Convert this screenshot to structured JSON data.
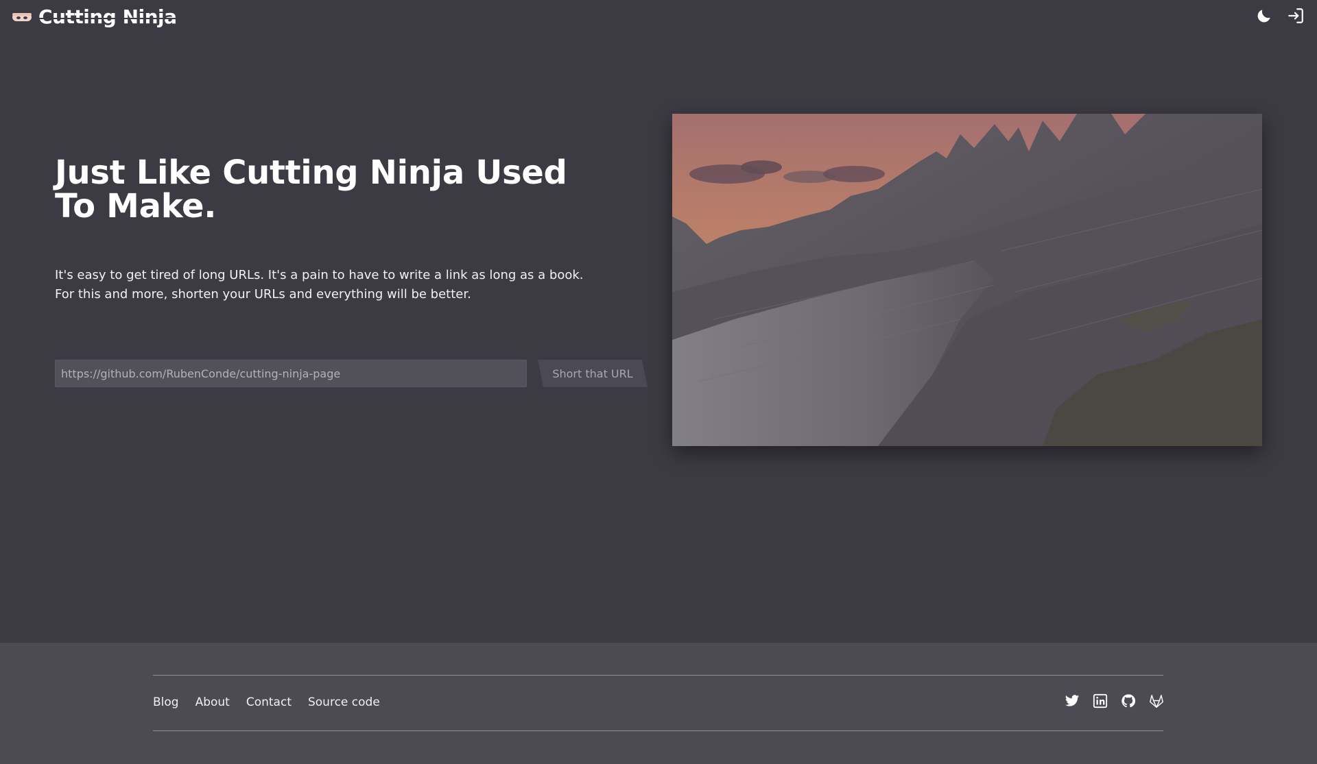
{
  "header": {
    "brand": "Cutting Ninja",
    "theme_toggle_icon": "moon-icon",
    "login_icon": "login-icon"
  },
  "hero": {
    "title": "Just Like Cutting Ninja Used To Make.",
    "description_line1": "It's easy to get tired of long URLs. It's a pain to have to write a link as long as a book.",
    "description_line2": "For this and more, shorten your URLs and everything will be better.",
    "url_placeholder": "https://github.com/RubenConde/cutting-ninja-page",
    "url_value": "",
    "submit_label": "Short that URL",
    "image_subject": "mountain-landscape-at-sunset"
  },
  "footer": {
    "links": [
      {
        "label": "Blog"
      },
      {
        "label": "About"
      },
      {
        "label": "Contact"
      },
      {
        "label": "Source code"
      }
    ],
    "social": [
      {
        "icon": "twitter-icon"
      },
      {
        "icon": "linkedin-icon"
      },
      {
        "icon": "github-icon"
      },
      {
        "icon": "gitlab-icon"
      }
    ]
  },
  "colors": {
    "background": "#3c3a43",
    "footer_background": "#4c4a53",
    "input_background": "#525059",
    "button_background": "#4b4953",
    "text": "#ffffff",
    "muted_text": "#a9a7af",
    "sky_accent": "#d98a6a"
  }
}
